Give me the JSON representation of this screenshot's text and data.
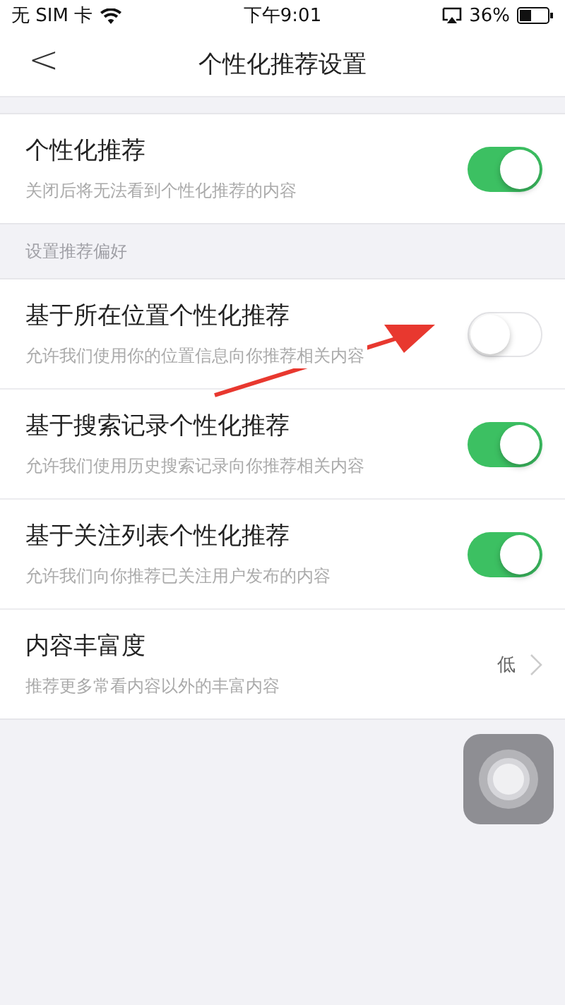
{
  "status_bar": {
    "carrier": "无 SIM 卡",
    "time": "下午9:01",
    "battery": "36%"
  },
  "nav": {
    "back": "<",
    "title": "个性化推荐设置"
  },
  "main_setting": {
    "kind": "toggle",
    "title": "个性化推荐",
    "subtitle": "关闭后将无法看到个性化推荐的内容",
    "on": true
  },
  "section_header": "设置推荐偏好",
  "settings": [
    {
      "kind": "toggle",
      "title": "基于所在位置个性化推荐",
      "subtitle": "允许我们使用你的位置信息向你推荐相关内容",
      "on": false
    },
    {
      "kind": "toggle",
      "title": "基于搜索记录个性化推荐",
      "subtitle": "允许我们使用历史搜索记录向你推荐相关内容",
      "on": true
    },
    {
      "kind": "toggle",
      "title": "基于关注列表个性化推荐",
      "subtitle": "允许我们向你推荐已关注用户发布的内容",
      "on": true
    },
    {
      "kind": "choice",
      "title": "内容丰富度",
      "subtitle": "推荐更多常看内容以外的丰富内容",
      "value": "低"
    }
  ]
}
